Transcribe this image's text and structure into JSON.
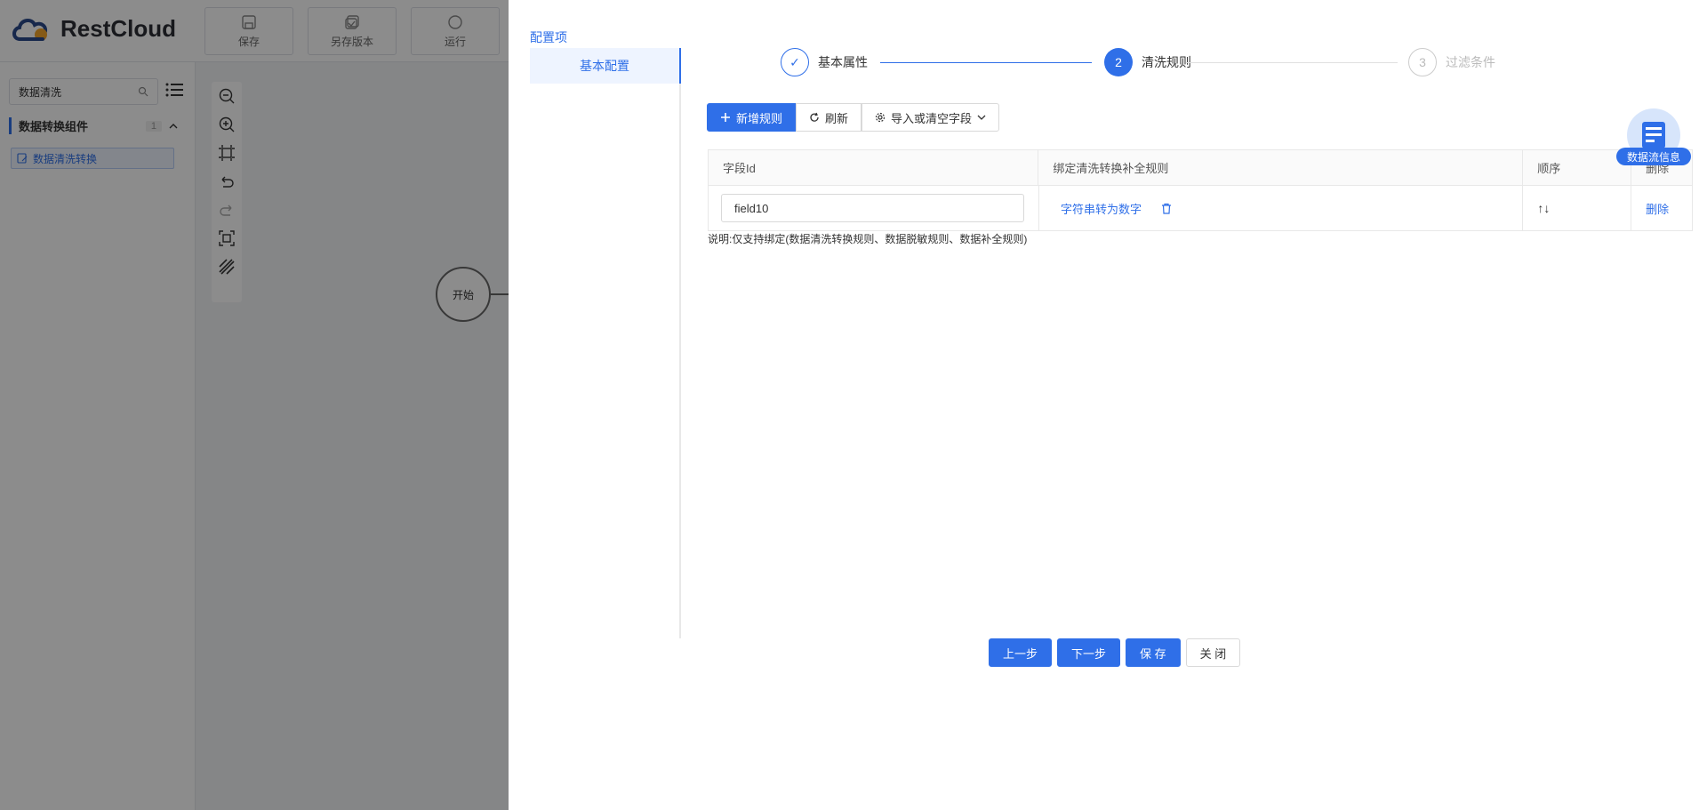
{
  "app": {
    "logo_text": "RestCloud",
    "toolbar": {
      "save": "保存",
      "save_version": "另存版本",
      "run": "运行"
    },
    "sidebar": {
      "search_value": "数据清洗",
      "group_title": "数据转换组件",
      "group_count": "1",
      "component": "数据清洗转换"
    },
    "canvas": {
      "start_node": "开始"
    }
  },
  "drawer": {
    "config_title": "配置项",
    "config_menu": "基本配置",
    "steps": [
      {
        "number": "✓",
        "label": "基本属性",
        "status": "done"
      },
      {
        "number": "2",
        "label": "清洗规则",
        "status": "active"
      },
      {
        "number": "3",
        "label": "过滤条件",
        "status": "wait"
      }
    ],
    "buttons": {
      "add_rule": "新增规则",
      "refresh": "刷新",
      "import_clear": "导入或清空字段"
    },
    "table": {
      "headers": [
        "字段Id",
        "绑定清洗转换补全规则",
        "顺序",
        "删除"
      ],
      "rows": [
        {
          "field_id": "field10",
          "rule": "字符串转为数字",
          "order": "↑↓",
          "delete": "删除"
        }
      ]
    },
    "note": "说明:仅支持绑定(数据清洗转换规则、数据脱敏规则、数据补全规则)",
    "float_label": "数据流信息",
    "footer": {
      "prev": "上一步",
      "next": "下一步",
      "save": "保 存",
      "close": "关 闭"
    }
  },
  "colors": {
    "accent": "#2f6fe8",
    "overlay": "rgba(0,0,0,0.45)"
  }
}
